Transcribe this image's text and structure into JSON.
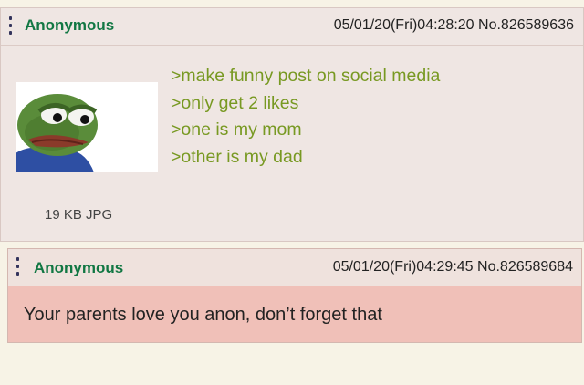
{
  "op": {
    "name": "Anonymous",
    "datetime": "05/01/20(Fri)04:28:20",
    "post_no": "No.826589636",
    "lines": [
      ">make funny post on social media",
      ">only get 2 likes",
      ">one is my mom",
      ">other is my dad"
    ],
    "file_info": "19 KB JPG",
    "thumbnail_icon": "sad-frog-icon"
  },
  "reply": {
    "name": "Anonymous",
    "datetime": "05/01/20(Fri)04:29:45",
    "post_no": "No.826589684",
    "text": "Your parents love you anon, don’t forget that"
  },
  "colors": {
    "name": "#117743",
    "greentext": "#789922",
    "post_bg": "#efe6e3",
    "highlight_bg": "#f0c0b8",
    "page_bg": "#f7f3e6"
  }
}
